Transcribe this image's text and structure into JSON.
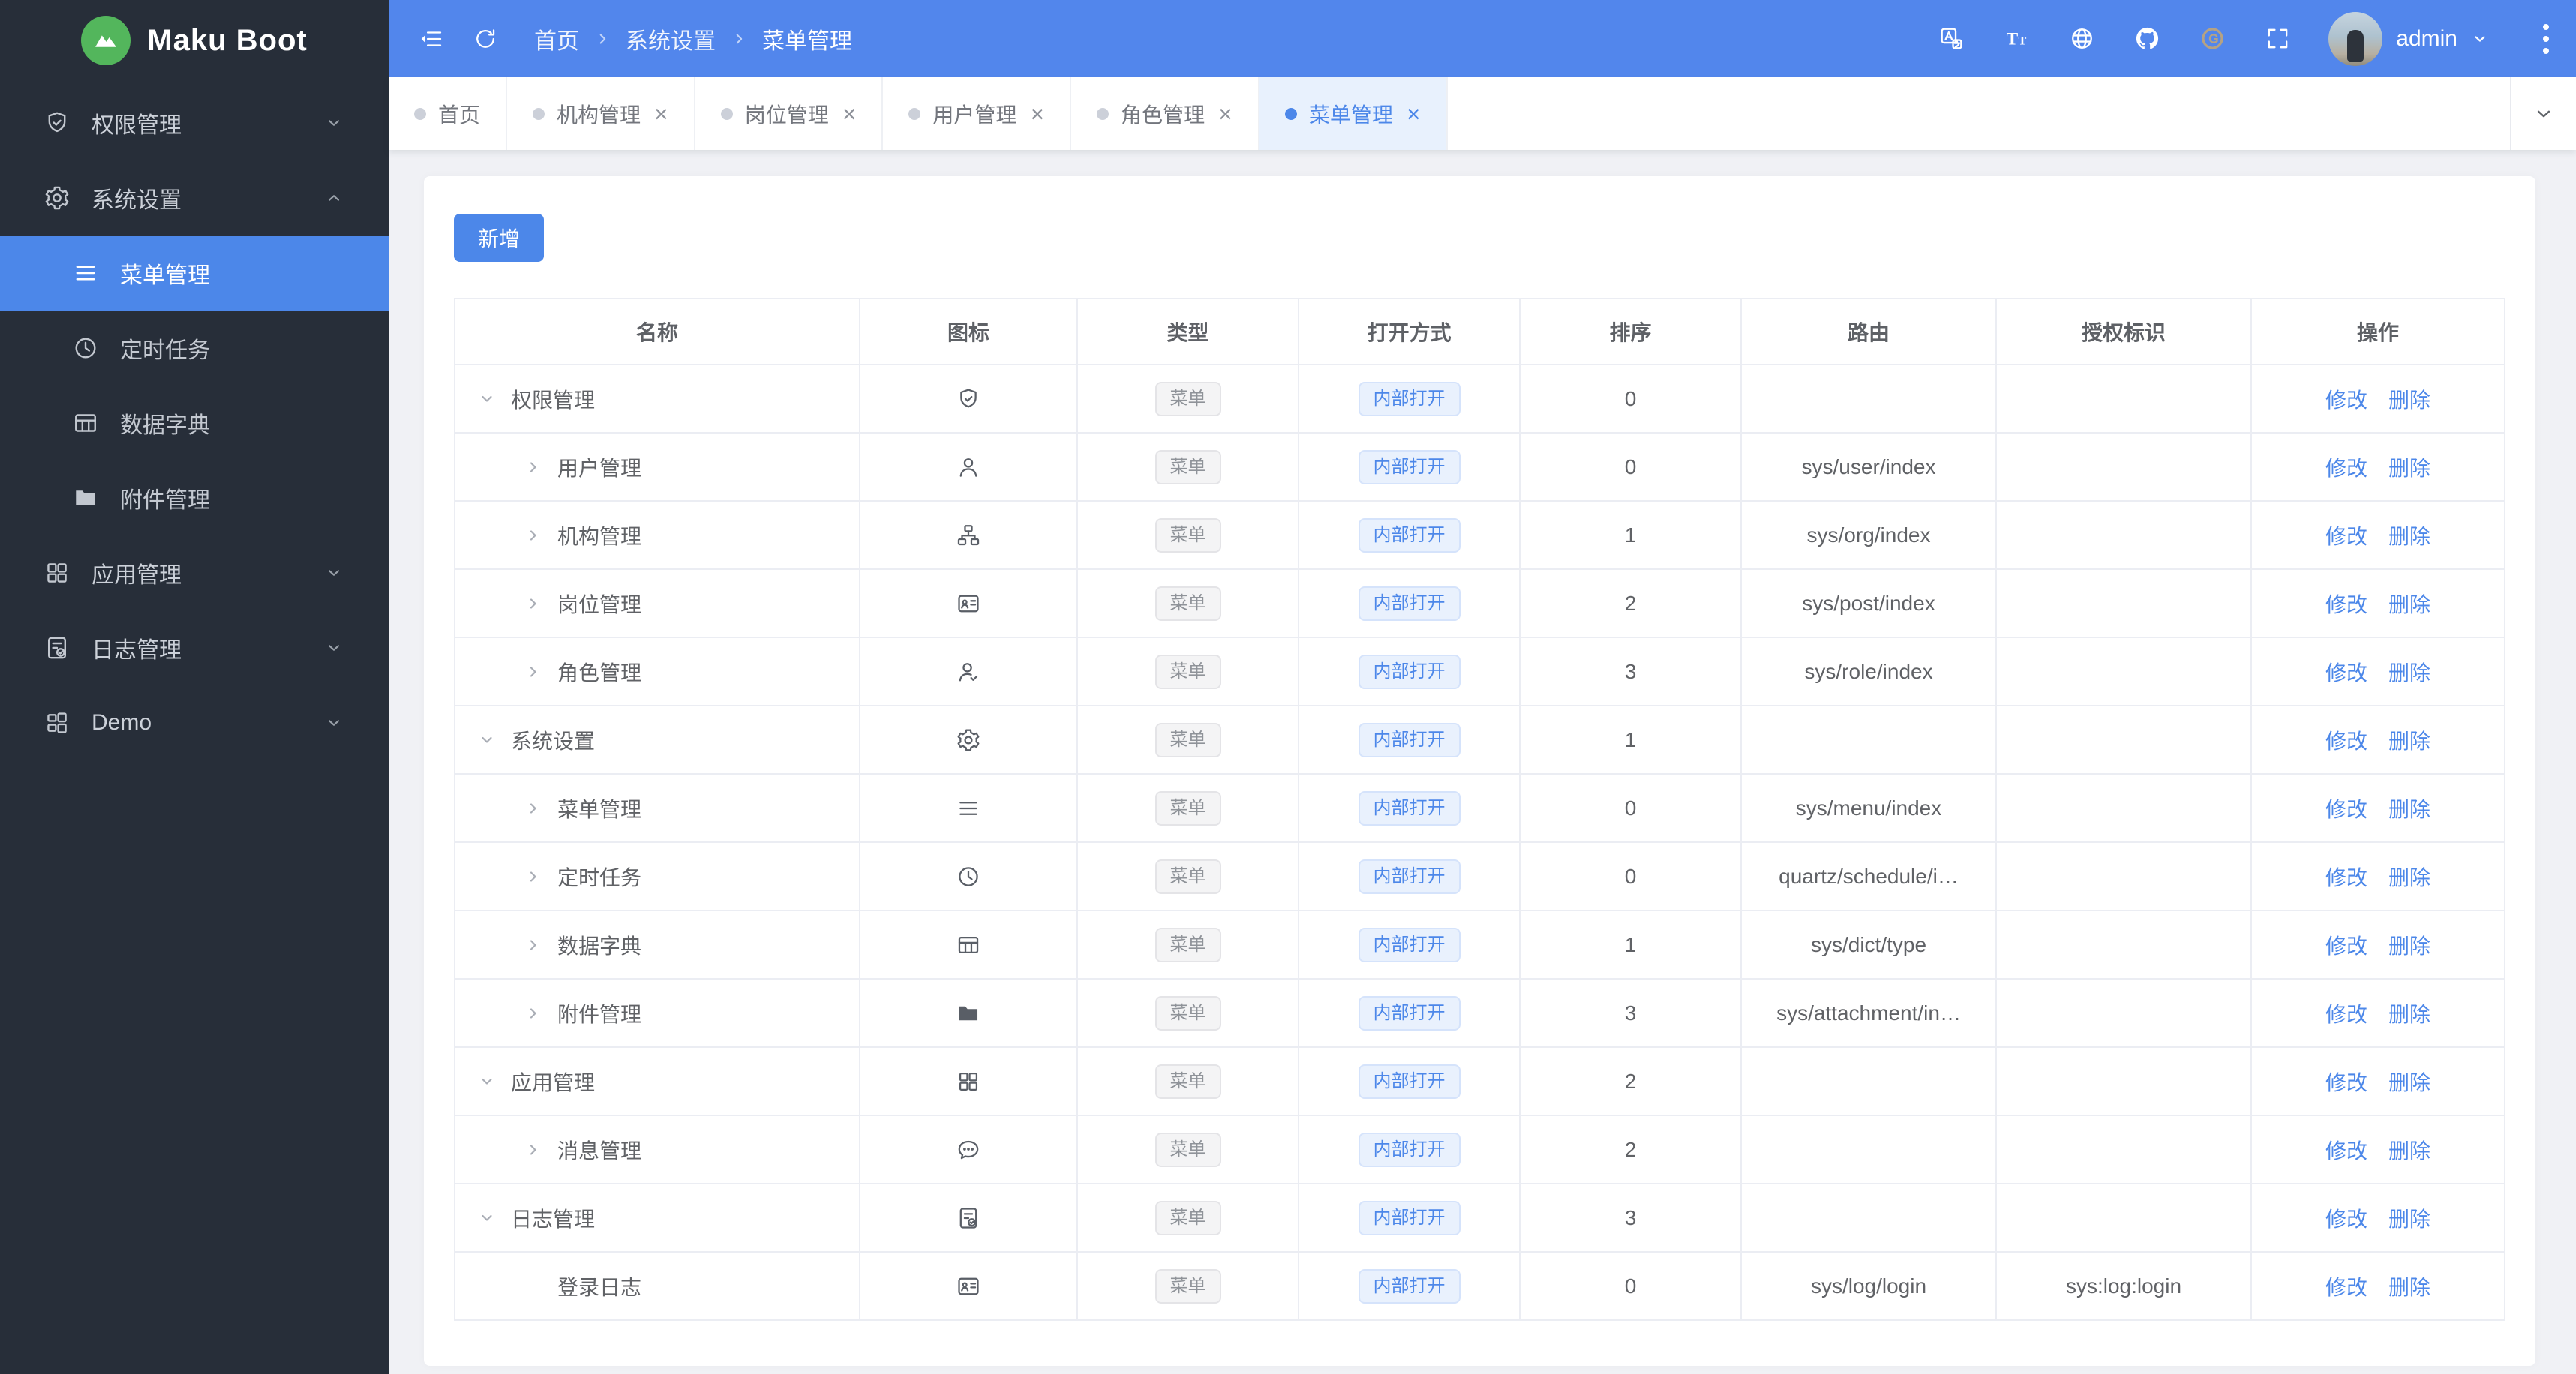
{
  "app": {
    "name": "Maku Boot"
  },
  "header": {
    "breadcrumb": [
      "首页",
      "系统设置",
      "菜单管理"
    ],
    "actions": [
      "translate",
      "font-size",
      "globe",
      "github",
      "gitee",
      "fullscreen"
    ],
    "user": {
      "name": "admin"
    }
  },
  "tabs": [
    {
      "label": "首页",
      "closable": false,
      "active": false
    },
    {
      "label": "机构管理",
      "closable": true,
      "active": false
    },
    {
      "label": "岗位管理",
      "closable": true,
      "active": false
    },
    {
      "label": "用户管理",
      "closable": true,
      "active": false
    },
    {
      "label": "角色管理",
      "closable": true,
      "active": false
    },
    {
      "label": "菜单管理",
      "closable": true,
      "active": true
    }
  ],
  "sidebar": {
    "items": [
      {
        "label": "权限管理",
        "icon": "shield-check",
        "chevron": "down"
      },
      {
        "label": "系统设置",
        "icon": "gear",
        "chevron": "up",
        "expanded": true,
        "children": [
          {
            "label": "菜单管理",
            "icon": "menu-lines",
            "active": true
          },
          {
            "label": "定时任务",
            "icon": "clock",
            "active": false
          },
          {
            "label": "数据字典",
            "icon": "dict-table",
            "active": false
          },
          {
            "label": "附件管理",
            "icon": "folder",
            "active": false
          }
        ]
      },
      {
        "label": "应用管理",
        "icon": "app-grid",
        "chevron": "down"
      },
      {
        "label": "日志管理",
        "icon": "log-doc",
        "chevron": "down"
      },
      {
        "label": "Demo",
        "icon": "demo-grid",
        "chevron": "down"
      }
    ]
  },
  "toolbar": {
    "add_label": "新增"
  },
  "table": {
    "columns": [
      "名称",
      "图标",
      "类型",
      "打开方式",
      "排序",
      "路由",
      "授权标识",
      "操作"
    ],
    "actions": [
      "修改",
      "删除"
    ],
    "rows": [
      {
        "name": "权限管理",
        "icon": "shield-check",
        "expand": "down",
        "indent": 0,
        "type": "菜单",
        "open": "内部打开",
        "sort": "0",
        "route": "",
        "perm": ""
      },
      {
        "name": "用户管理",
        "icon": "user",
        "expand": "right",
        "indent": 1,
        "type": "菜单",
        "open": "内部打开",
        "sort": "0",
        "route": "sys/user/index",
        "perm": ""
      },
      {
        "name": "机构管理",
        "icon": "org-tree",
        "expand": "right",
        "indent": 1,
        "type": "菜单",
        "open": "内部打开",
        "sort": "1",
        "route": "sys/org/index",
        "perm": ""
      },
      {
        "name": "岗位管理",
        "icon": "postcard",
        "expand": "right",
        "indent": 1,
        "type": "菜单",
        "open": "内部打开",
        "sort": "2",
        "route": "sys/post/index",
        "perm": ""
      },
      {
        "name": "角色管理",
        "icon": "user-check",
        "expand": "right",
        "indent": 1,
        "type": "菜单",
        "open": "内部打开",
        "sort": "3",
        "route": "sys/role/index",
        "perm": ""
      },
      {
        "name": "系统设置",
        "icon": "gear",
        "expand": "down",
        "indent": 0,
        "type": "菜单",
        "open": "内部打开",
        "sort": "1",
        "route": "",
        "perm": ""
      },
      {
        "name": "菜单管理",
        "icon": "menu-lines",
        "expand": "right",
        "indent": 1,
        "type": "菜单",
        "open": "内部打开",
        "sort": "0",
        "route": "sys/menu/index",
        "perm": ""
      },
      {
        "name": "定时任务",
        "icon": "clock",
        "expand": "right",
        "indent": 1,
        "type": "菜单",
        "open": "内部打开",
        "sort": "0",
        "route": "quartz/schedule/i…",
        "perm": ""
      },
      {
        "name": "数据字典",
        "icon": "dict-table",
        "expand": "right",
        "indent": 1,
        "type": "菜单",
        "open": "内部打开",
        "sort": "1",
        "route": "sys/dict/type",
        "perm": ""
      },
      {
        "name": "附件管理",
        "icon": "folder",
        "expand": "right",
        "indent": 1,
        "type": "菜单",
        "open": "内部打开",
        "sort": "3",
        "route": "sys/attachment/in…",
        "perm": ""
      },
      {
        "name": "应用管理",
        "icon": "app-grid",
        "expand": "down",
        "indent": 0,
        "type": "菜单",
        "open": "内部打开",
        "sort": "2",
        "route": "",
        "perm": ""
      },
      {
        "name": "消息管理",
        "icon": "message-dots",
        "expand": "right",
        "indent": 1,
        "type": "菜单",
        "open": "内部打开",
        "sort": "2",
        "route": "",
        "perm": ""
      },
      {
        "name": "日志管理",
        "icon": "log-doc",
        "expand": "down",
        "indent": 0,
        "type": "菜单",
        "open": "内部打开",
        "sort": "3",
        "route": "",
        "perm": ""
      },
      {
        "name": "登录日志",
        "icon": "postcard",
        "expand": "none",
        "indent": 1,
        "type": "菜单",
        "open": "内部打开",
        "sort": "0",
        "route": "sys/log/login",
        "perm": "sys:log:login"
      }
    ]
  },
  "colors": {
    "primary": "#4c87e9",
    "header_bg": "#5286ec",
    "sidebar_bg": "#272e39",
    "logo_green": "#53b65c",
    "tab_active_bg": "#e8f1fd",
    "page_bg": "#f0f1f5"
  }
}
